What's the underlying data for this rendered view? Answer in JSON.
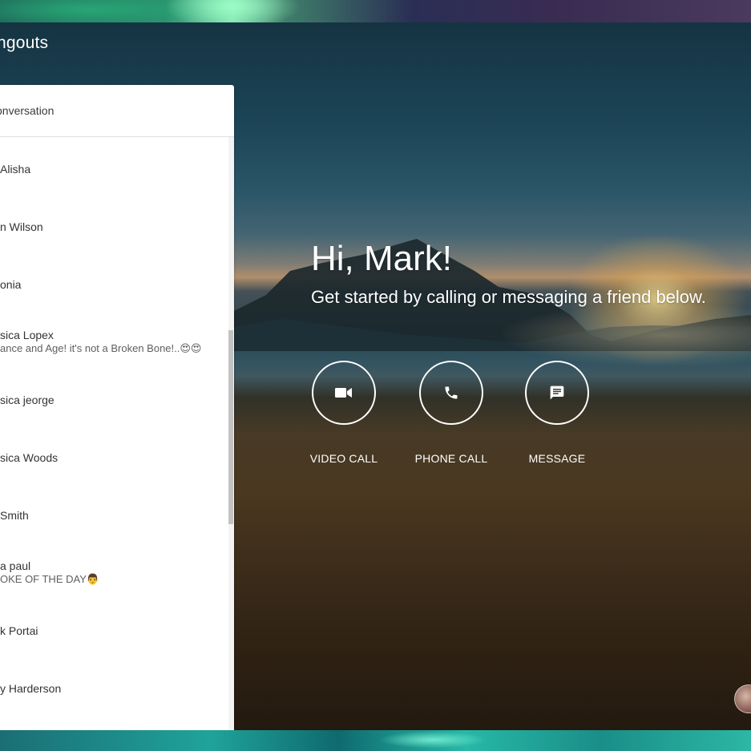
{
  "app": {
    "title": "ngouts"
  },
  "panel": {
    "new_conversation_label": "conversation",
    "conversations": [
      {
        "name": "Alisha",
        "snippet": ""
      },
      {
        "name": "n Wilson",
        "snippet": ""
      },
      {
        "name": "onia",
        "snippet": ""
      },
      {
        "name": "sica Lopex",
        "snippet": "ance and Age! it's not a Broken Bone!..😍😍"
      },
      {
        "name": "sica jeorge",
        "snippet": ""
      },
      {
        "name": "sica Woods",
        "snippet": ""
      },
      {
        "name": "Smith",
        "snippet": ""
      },
      {
        "name": "a paul",
        "snippet": "OKE OF THE DAY👨"
      },
      {
        "name": "k Portai",
        "snippet": ""
      },
      {
        "name": "y Harderson",
        "snippet": ""
      }
    ]
  },
  "welcome": {
    "greeting": "Hi, Mark!",
    "subtitle": "Get started by calling or messaging a friend below."
  },
  "actions": {
    "video_call": "VIDEO CALL",
    "phone_call": "PHONE CALL",
    "message": "MESSAGE"
  },
  "colors": {
    "panel_background": "#ffffff",
    "text_primary": "#333333",
    "text_on_image": "#ffffff"
  },
  "icons": {
    "video_call": "video-camera-icon",
    "phone_call": "phone-icon",
    "message": "chat-bubble-icon"
  }
}
